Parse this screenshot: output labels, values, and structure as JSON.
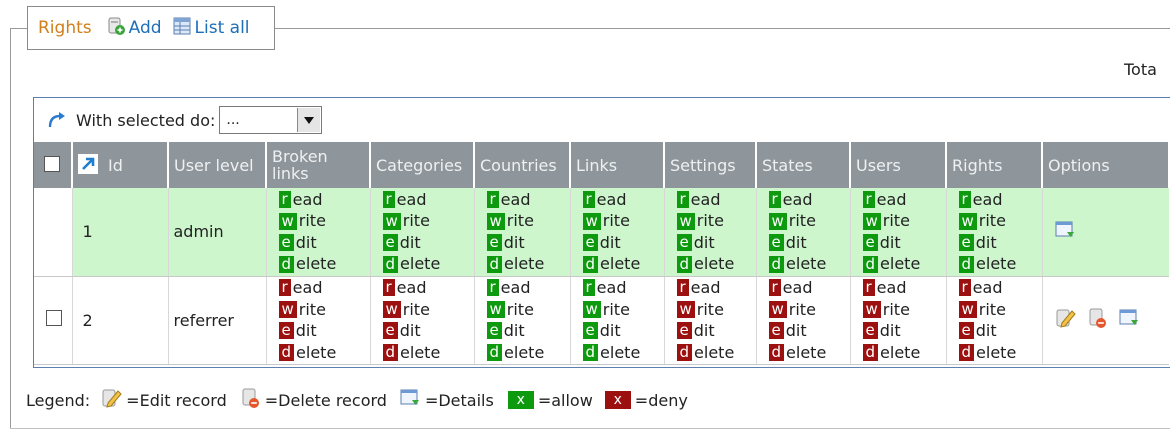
{
  "header": {
    "title": "Rights",
    "add_label": "Add",
    "list_all_label": "List all",
    "total_label": "Tota"
  },
  "toolbar": {
    "with_selected_label": "With selected do:",
    "select_value": "..."
  },
  "columns": [
    "Id",
    "User level",
    "Broken links",
    "Categories",
    "Countries",
    "Links",
    "Settings",
    "States",
    "Users",
    "Rights",
    "Options"
  ],
  "permissions": {
    "read_letter": "r",
    "read_rest": "ead",
    "write_letter": "w",
    "write_rest": "rite",
    "edit_letter": "e",
    "edit_rest": "dit",
    "delete_letter": "d",
    "delete_rest": "elete"
  },
  "rows": [
    {
      "id": "1",
      "user_level": "admin",
      "selectable": false,
      "rights": {
        "broken_links": "allow",
        "categories": "allow",
        "countries": "allow",
        "links": "allow",
        "settings": "allow",
        "states": "allow",
        "users": "allow",
        "rights": "allow"
      },
      "options": [
        "details-icon"
      ]
    },
    {
      "id": "2",
      "user_level": "referrer",
      "selectable": true,
      "rights": {
        "broken_links": "deny",
        "categories": "deny",
        "countries": "allow",
        "links": "allow",
        "settings": "deny",
        "states": "deny",
        "users": "deny",
        "rights": "deny"
      },
      "options": [
        "edit-icon",
        "delete-icon",
        "details-icon"
      ]
    }
  ],
  "legend": {
    "prefix": "Legend:",
    "edit": "=Edit record",
    "delete": "=Delete record",
    "details": "=Details",
    "allow_swatch": "x",
    "allow": "=allow",
    "deny_swatch": "x",
    "deny": "=deny"
  },
  "colors": {
    "allow": "#0e9a0e",
    "deny": "#9c1010",
    "row_highlight": "#cdf6cd",
    "header_bg": "#8f969b",
    "title_orange": "#d07f1a",
    "link_blue": "#1d6fb8"
  }
}
